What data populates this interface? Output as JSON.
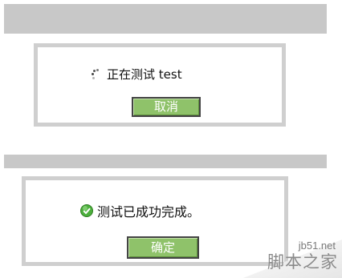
{
  "dialog1": {
    "status_icon": "spinner-icon",
    "message": "正在测试 test",
    "button_label": "取消"
  },
  "dialog2": {
    "status_icon": "success-check-icon",
    "message": "测试已成功完成。",
    "button_label": "确定"
  },
  "watermark": {
    "site": "jb51.net",
    "name": "脚本之家"
  },
  "colors": {
    "button_fill": "#8fc26a",
    "panel_border": "#cfcfcf",
    "bar": "#c8c8c8",
    "success": "#4caf3c"
  }
}
